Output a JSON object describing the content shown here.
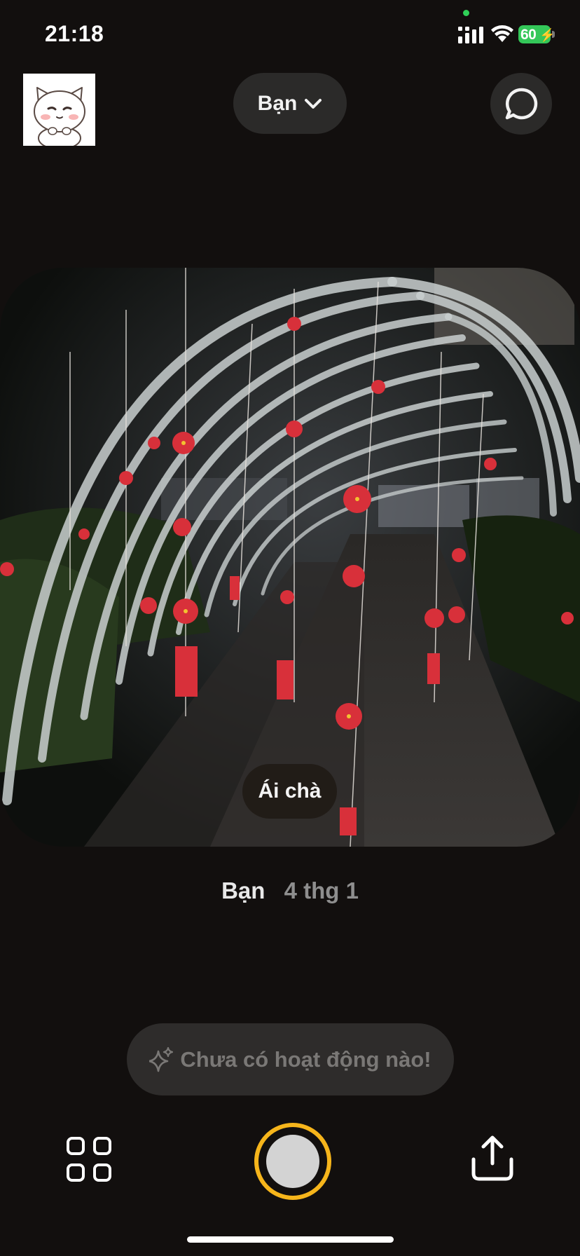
{
  "status_bar": {
    "time": "21:18",
    "battery_level": "60",
    "icons": [
      "signal-icon",
      "wifi-icon",
      "battery-charging-icon"
    ]
  },
  "header": {
    "avatar_icon": "cat-sticker-avatar",
    "friend_selector_label": "Bạn",
    "selector_icon": "chevron-down-icon",
    "chat_icon": "chat-bubble-icon"
  },
  "photo": {
    "description_icon": "night-archway-photo",
    "reaction_text": "Ái chà"
  },
  "meta": {
    "author": "Bạn",
    "date": "4 thg 1"
  },
  "activity": {
    "icon": "sparkle-icon",
    "text": "Chưa có hoạt động nào!"
  },
  "bottom_bar": {
    "icons": [
      "grid-icon",
      "shutter-button",
      "share-icon"
    ],
    "shutter_ring_color": "#f6b51b"
  },
  "colors": {
    "background": "#120f0e",
    "pill": "#2b2a29",
    "battery": "#34c759"
  }
}
